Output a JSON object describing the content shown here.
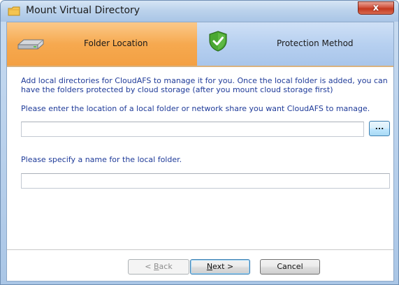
{
  "window": {
    "title": "Mount Virtual Directory",
    "close_glyph": "x"
  },
  "tabs": [
    {
      "label": "Folder Location",
      "icon": "drive-icon",
      "active": true,
      "color": "#f6a94f"
    },
    {
      "label": "Protection Method",
      "icon": "shield-check-icon",
      "active": false,
      "color": "#b7d0f0"
    }
  ],
  "content": {
    "description": "Add local directories for CloudAFS to manage it for you. Once the local folder is added, you can have the folders protected by cloud storage (after you mount cloud storage first)",
    "folder_prompt": "Please enter the location of a local folder or network share you want CloudAFS to manage.",
    "folder_value": "",
    "browse_label": "...",
    "name_prompt": "Please specify a name for the local folder.",
    "name_value": ""
  },
  "buttons": {
    "back_prefix": "< ",
    "back_mnemonic": "B",
    "back_rest": "ack",
    "next_mnemonic": "N",
    "next_rest": "ext >",
    "cancel_label": "Cancel"
  },
  "colors": {
    "text_blue": "#1f3b99",
    "active_tab": "#f6a94f",
    "inactive_tab": "#b7d0f0"
  }
}
